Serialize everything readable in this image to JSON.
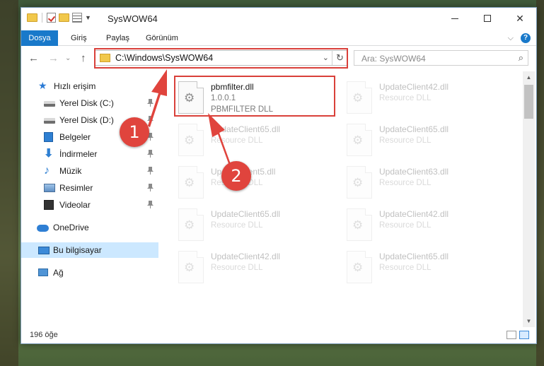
{
  "window": {
    "title": "SysWOW64"
  },
  "ribbon": {
    "tabs": [
      {
        "label": "Dosya"
      },
      {
        "label": "Giriş"
      },
      {
        "label": "Paylaş"
      },
      {
        "label": "Görünüm"
      }
    ],
    "help": "?"
  },
  "navbar": {
    "address": "C:\\Windows\\SysWOW64",
    "search_placeholder": "Ara: SysWOW64"
  },
  "sidebar": {
    "items": [
      {
        "label": "Hızlı erişim",
        "icon": "star-icon"
      },
      {
        "label": "Yerel Disk (C:)",
        "icon": "disk-icon"
      },
      {
        "label": "Yerel Disk (D:)",
        "icon": "disk-icon"
      },
      {
        "label": "Belgeler",
        "icon": "documents-icon"
      },
      {
        "label": "İndirmeler",
        "icon": "download-icon"
      },
      {
        "label": "Müzik",
        "icon": "music-icon"
      },
      {
        "label": "Resimler",
        "icon": "pictures-icon"
      },
      {
        "label": "Videolar",
        "icon": "videos-icon"
      },
      {
        "label": "OneDrive",
        "icon": "cloud-icon"
      },
      {
        "label": "Bu bilgisayar",
        "icon": "computer-icon"
      },
      {
        "label": "Ağ",
        "icon": "network-icon"
      }
    ]
  },
  "files": [
    {
      "name": "pbmfilter.dll",
      "line1": "1.0.0.1",
      "line2": "PBMFILTER DLL"
    },
    {
      "name": "UpdateClient42.dll",
      "line1": "Resource DLL",
      "line2": ""
    },
    {
      "name": "UpdateClient65.dll",
      "line1": "Resource DLL",
      "line2": ""
    },
    {
      "name": "UpdateClient65.dll",
      "line1": "Resource DLL",
      "line2": ""
    },
    {
      "name": "UpdateClient5.dll",
      "line1": "Resource DLL",
      "line2": ""
    },
    {
      "name": "UpdateClient63.dll",
      "line1": "Resource DLL",
      "line2": ""
    },
    {
      "name": "UpdateClient65.dll",
      "line1": "Resource DLL",
      "line2": ""
    },
    {
      "name": "UpdateClient42.dll",
      "line1": "Resource DLL",
      "line2": ""
    },
    {
      "name": "UpdateClient42.dll",
      "line1": "Resource DLL",
      "line2": ""
    },
    {
      "name": "UpdateClient65.dll",
      "line1": "Resource DLL",
      "line2": ""
    }
  ],
  "status": {
    "count": "196 öğe"
  },
  "annotations": {
    "step1": "1",
    "step2": "2",
    "color": "#e0443d"
  }
}
